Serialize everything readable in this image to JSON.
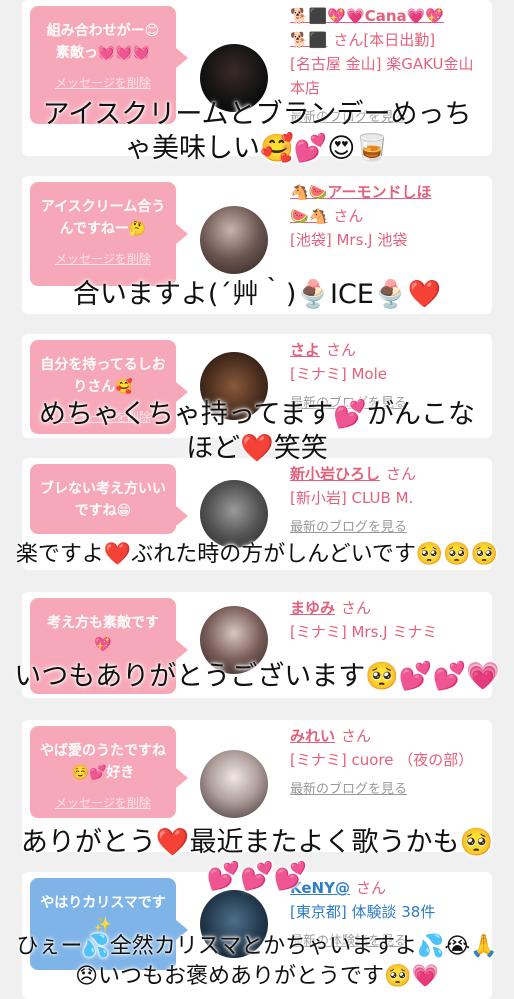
{
  "colors": {
    "pink": "#f7a8b8",
    "blue": "#7fb4e8",
    "name_pink": "#e4607b",
    "name_blue": "#2f7cc7"
  },
  "delete_label": "メッセージを削除",
  "blog_label": "最新のブログを見る",
  "taiken_label": "最新の体験談を見る",
  "cards": [
    {
      "bubble": "組み合わせがー😊素敵っ💓💓💓",
      "name": "🐕⬛💖💗Cana💗💖",
      "name2": "🐕⬛",
      "san": "さん",
      "extra": "[本日出勤]",
      "loc": "[名古屋 金山] 楽GAKU金山本店"
    },
    {
      "bubble": "アイスクリーム合うんですねー🤔",
      "name": "🐴🍉アーモンドしほ",
      "name2": "🍉🐴",
      "san": "さん",
      "loc": "[池袋] Mrs.J 池袋"
    },
    {
      "bubble": "自分を持ってるしおりさん🥰",
      "name": "さよ",
      "san": "さん",
      "loc": "[ミナミ] Mole"
    },
    {
      "bubble": "ブレない考え方いいですね😁",
      "name": "新小岩ひろし",
      "san": "さん",
      "loc": "[新小岩] CLUB M."
    },
    {
      "bubble": "考え方も素敵です💖",
      "name": "まゆみ",
      "san": "さん",
      "loc": "[ミナミ] Mrs.J ミナミ"
    },
    {
      "bubble": "やば愛のうたですね☺️💕好き",
      "name": "みれい",
      "san": "さん",
      "loc": "[ミナミ] cuore （夜の部）"
    },
    {
      "bubble": "やはりカリスマです✨",
      "name": "KeNY@",
      "san": "さん",
      "loc": "[東京都] 体験談 38件"
    }
  ],
  "overlays": [
    "アイスクリームとブランデーめっちゃ美味しい🥰💕😍🥃",
    "合いますよ(´艸｀)🍨ICE🍨❤️",
    "めちゃくちゃ持ってます💕がんこなほど❤️笑笑",
    "楽ですよ❤️ぶれた時の方がしんどいです🥺🥺🥺",
    "いつもありがとうございます🥺💕💕💗",
    "ありがとう❤️最近またよく歌うかも🥺💕💕💕",
    "ひぇー💦全然カリスマとかちゃいますよ💦😭🙏😞いつもお褒めありがとうです🥺💗"
  ]
}
